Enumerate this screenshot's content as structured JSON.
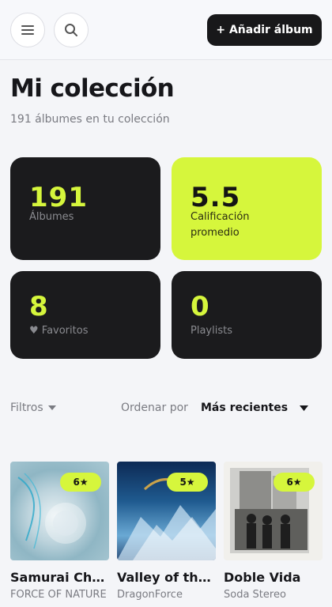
{
  "header": {
    "menu_icon": "menu-icon",
    "search_icon": "search-icon",
    "add_button_label": "+ Añadir álbum"
  },
  "page": {
    "title": "Mi colección",
    "subtitle": "191 álbumes en tu colección"
  },
  "stats": [
    {
      "value": "191",
      "label": "Álbumes"
    },
    {
      "value": "5.5",
      "label": "Calificación promedio"
    },
    {
      "value": "8",
      "label": "♥ Favoritos"
    },
    {
      "value": "0",
      "label": "Playlists"
    }
  ],
  "toolbar": {
    "filters_label": "Filtros",
    "sort_label": "Ordenar por",
    "sort_value": "Más recientes"
  },
  "albums": [
    {
      "title": "Samurai Champloo",
      "artist": "FORCE OF NATURE",
      "rating": "6★"
    },
    {
      "title": "Valley of the Damned",
      "artist": "DragonForce",
      "rating": "5★"
    },
    {
      "title": "Doble Vida",
      "artist": "Soda Stereo",
      "rating": "6★"
    }
  ],
  "colors": {
    "accent": "#d6f63c",
    "dark_card": "#1b1b1d",
    "background": "#f4f5f8"
  }
}
